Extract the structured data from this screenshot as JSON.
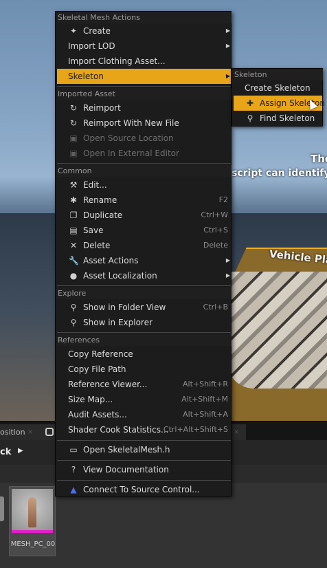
{
  "viewport": {
    "overlay_text_1": "These I",
    "overlay_text_2": "script can identify and",
    "overlay_text_3": "Vehicle Pla"
  },
  "bottom": {
    "tab_composition": "osition",
    "tab_close": "×",
    "path_back": "ck",
    "asset_name": "MESH_PC_00"
  },
  "context_menu": {
    "sections": {
      "skeletal_mesh_actions": "Skeletal Mesh Actions",
      "imported_asset": "Imported Asset",
      "common": "Common",
      "explore": "Explore",
      "references": "References"
    },
    "items": {
      "create": "Create",
      "import_lod": "Import LOD",
      "import_clothing_asset": "Import Clothing Asset...",
      "skeleton": "Skeleton",
      "reimport": "Reimport",
      "reimport_with_new_file": "Reimport With New File",
      "open_source_location": "Open Source Location",
      "open_in_external_editor": "Open In External Editor",
      "edit": "Edit...",
      "rename": "Rename",
      "duplicate": "Duplicate",
      "save": "Save",
      "delete": "Delete",
      "asset_actions": "Asset Actions",
      "asset_localization": "Asset Localization",
      "show_in_folder_view": "Show in Folder View",
      "show_in_explorer": "Show in Explorer",
      "copy_reference": "Copy Reference",
      "copy_file_path": "Copy File Path",
      "reference_viewer": "Reference Viewer...",
      "size_map": "Size Map...",
      "audit_assets": "Audit Assets...",
      "shader_cook_statistics": "Shader Cook Statistics...",
      "open_skeletalmesh_h": "Open SkeletalMesh.h",
      "view_documentation": "View Documentation",
      "connect_to_source_control": "Connect To Source Control..."
    },
    "shortcuts": {
      "rename": "F2",
      "duplicate": "Ctrl+W",
      "save": "Ctrl+S",
      "delete": "Delete",
      "show_in_folder_view": "Ctrl+B",
      "reference_viewer": "Alt+Shift+R",
      "size_map": "Alt+Shift+M",
      "audit_assets": "Alt+Shift+A",
      "shader_cook_statistics": "Ctrl+Alt+Shift+S"
    },
    "highlight_color": "#e8a518"
  },
  "skeleton_submenu": {
    "header": "Skeleton",
    "items": {
      "create_skeleton": "Create Skeleton",
      "assign_skeleton": "Assign Skeleton",
      "find_skeleton": "Find Skeleton"
    }
  },
  "icons": {
    "create": "create-icon",
    "reimport": "reimport-icon",
    "reimport_with_new_file": "reimport-file-icon",
    "open_source_location": "folder-disabled-icon",
    "open_in_external_editor": "external-editor-disabled-icon",
    "edit": "hammer-icon",
    "rename": "rename-icon",
    "duplicate": "duplicate-icon",
    "save": "save-icon",
    "delete": "delete-icon",
    "asset_actions": "wrench-icon",
    "asset_localization": "globe-icon",
    "show_in_folder_view": "magnifier-icon",
    "show_in_explorer": "magnifier-icon",
    "open_skeletalmesh_h": "code-icon",
    "view_documentation": "help-icon",
    "connect_to_source_control": "source-control-icon",
    "assign_skeleton": "assign-skeleton-icon",
    "find_skeleton": "magnifier-icon"
  }
}
